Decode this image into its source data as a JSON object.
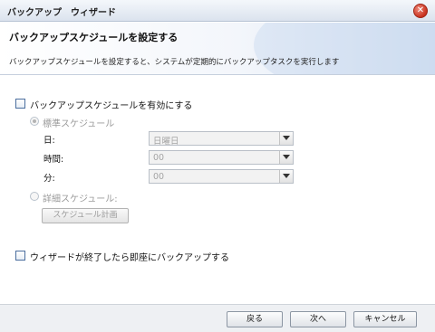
{
  "window": {
    "title": "バックアップ　ウィザード"
  },
  "header": {
    "title": "バックアップスケジュールを設定する",
    "description": "バックアップスケジュールを設定すると、システムが定期的にバックアップタスクを実行します"
  },
  "options": {
    "enable_schedule": {
      "label": "バックアップスケジュールを有効にする",
      "checked": false
    },
    "standard_schedule": {
      "label": "標準スケジュール",
      "selected": true,
      "enabled": false
    },
    "fields": {
      "day": {
        "label": "日:",
        "value": "日曜日"
      },
      "hour": {
        "label": "時間:",
        "value": "00"
      },
      "minute": {
        "label": "分:",
        "value": "00"
      }
    },
    "detailed_schedule": {
      "label": "詳細スケジュール:",
      "selected": false,
      "enabled": false
    },
    "schedule_plan_button": "スケジュール計画",
    "backup_after_wizard": {
      "label": "ウィザードが終了したら即座にバックアップする",
      "checked": false
    }
  },
  "footer": {
    "back_label": "戻る",
    "next_label": "次へ",
    "cancel_label": "キャンセル"
  },
  "colors": {
    "close_button": "#c8321f",
    "checkbox_border": "#4b6e9e",
    "disabled_text": "#9a9a9a"
  }
}
